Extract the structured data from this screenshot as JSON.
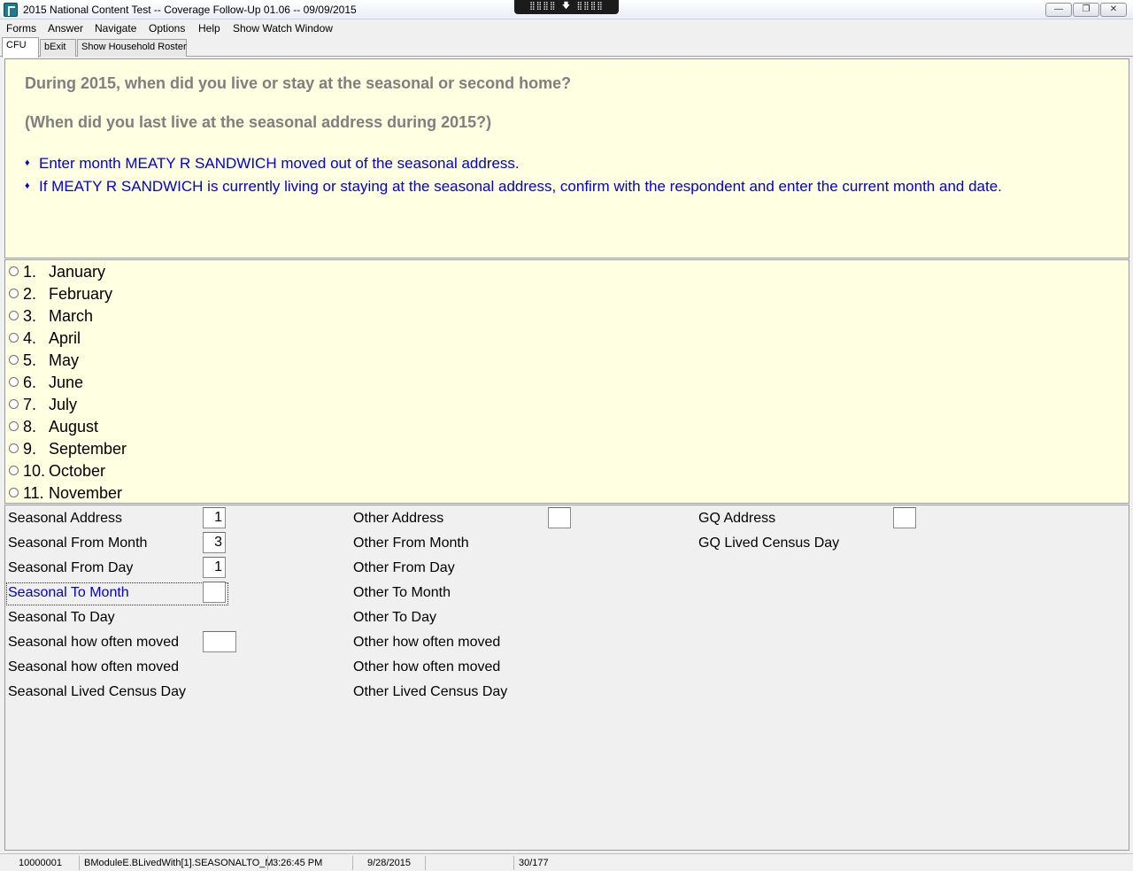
{
  "window": {
    "title": "2015 National Content Test -- Coverage Follow-Up 01.06 -- 09/09/2015",
    "remote_bar": "⣿⣿⣿⣿ 🡇 ⣿⣿⣿⣿",
    "minimize": "—",
    "maximize": "❐",
    "close": "✕"
  },
  "menu": [
    "Forms",
    "Answer",
    "Navigate",
    "Options",
    "Help",
    "Show Watch Window"
  ],
  "tabs": [
    {
      "label": "CFU",
      "active": true
    },
    {
      "label": "bExit",
      "active": false
    },
    {
      "label": "Show Household Roster",
      "active": false
    }
  ],
  "question": {
    "text": "During 2015, when did you live or stay at the seasonal or second home?",
    "alt_text": "(When did you last live at the seasonal address during 2015?)",
    "bullet": "♦",
    "instructions": [
      "Enter month MEATY R SANDWICH moved out of the seasonal address.",
      "If MEATY R SANDWICH is currently living or staying at the seasonal address, confirm with the respondent and enter the current month and date."
    ]
  },
  "answers": [
    {
      "num": "1.",
      "label": "January"
    },
    {
      "num": "2.",
      "label": "February"
    },
    {
      "num": "3.",
      "label": "March"
    },
    {
      "num": "4.",
      "label": "April"
    },
    {
      "num": "5.",
      "label": "May"
    },
    {
      "num": "6.",
      "label": "June"
    },
    {
      "num": "7.",
      "label": "July"
    },
    {
      "num": "8.",
      "label": "August"
    },
    {
      "num": "9.",
      "label": "September"
    },
    {
      "num": "10.",
      "label": "October"
    },
    {
      "num": "11.",
      "label": "November"
    }
  ],
  "fields": {
    "seasonal": [
      {
        "label": "Seasonal Address",
        "value": "1"
      },
      {
        "label": "Seasonal From Month",
        "value": "3"
      },
      {
        "label": "Seasonal From Day",
        "value": "1"
      },
      {
        "label": "Seasonal To Month",
        "value": ""
      },
      {
        "label": "Seasonal To Day",
        "value": ""
      },
      {
        "label": "Seasonal how often moved",
        "value": ""
      },
      {
        "label": "Seasonal how often moved",
        "value": ""
      },
      {
        "label": "Seasonal Lived Census Day",
        "value": ""
      }
    ],
    "other": [
      {
        "label": "Other Address",
        "value": ""
      },
      {
        "label": "Other From Month",
        "value": ""
      },
      {
        "label": "Other From Day",
        "value": ""
      },
      {
        "label": "Other To Month",
        "value": ""
      },
      {
        "label": "Other To Day",
        "value": ""
      },
      {
        "label": "Other how often moved",
        "value": ""
      },
      {
        "label": "Other how often moved",
        "value": ""
      },
      {
        "label": "Other Lived Census Day",
        "value": ""
      }
    ],
    "gq": [
      {
        "label": "GQ Address",
        "value": ""
      },
      {
        "label": "GQ Lived Census Day",
        "value": ""
      }
    ]
  },
  "status": {
    "case_id": "10000001",
    "field_path": "BModuleE.BLivedWith[1].SEASONALTO_M",
    "time": "3:26:45 PM",
    "date": "9/28/2015",
    "position": "30/177"
  }
}
